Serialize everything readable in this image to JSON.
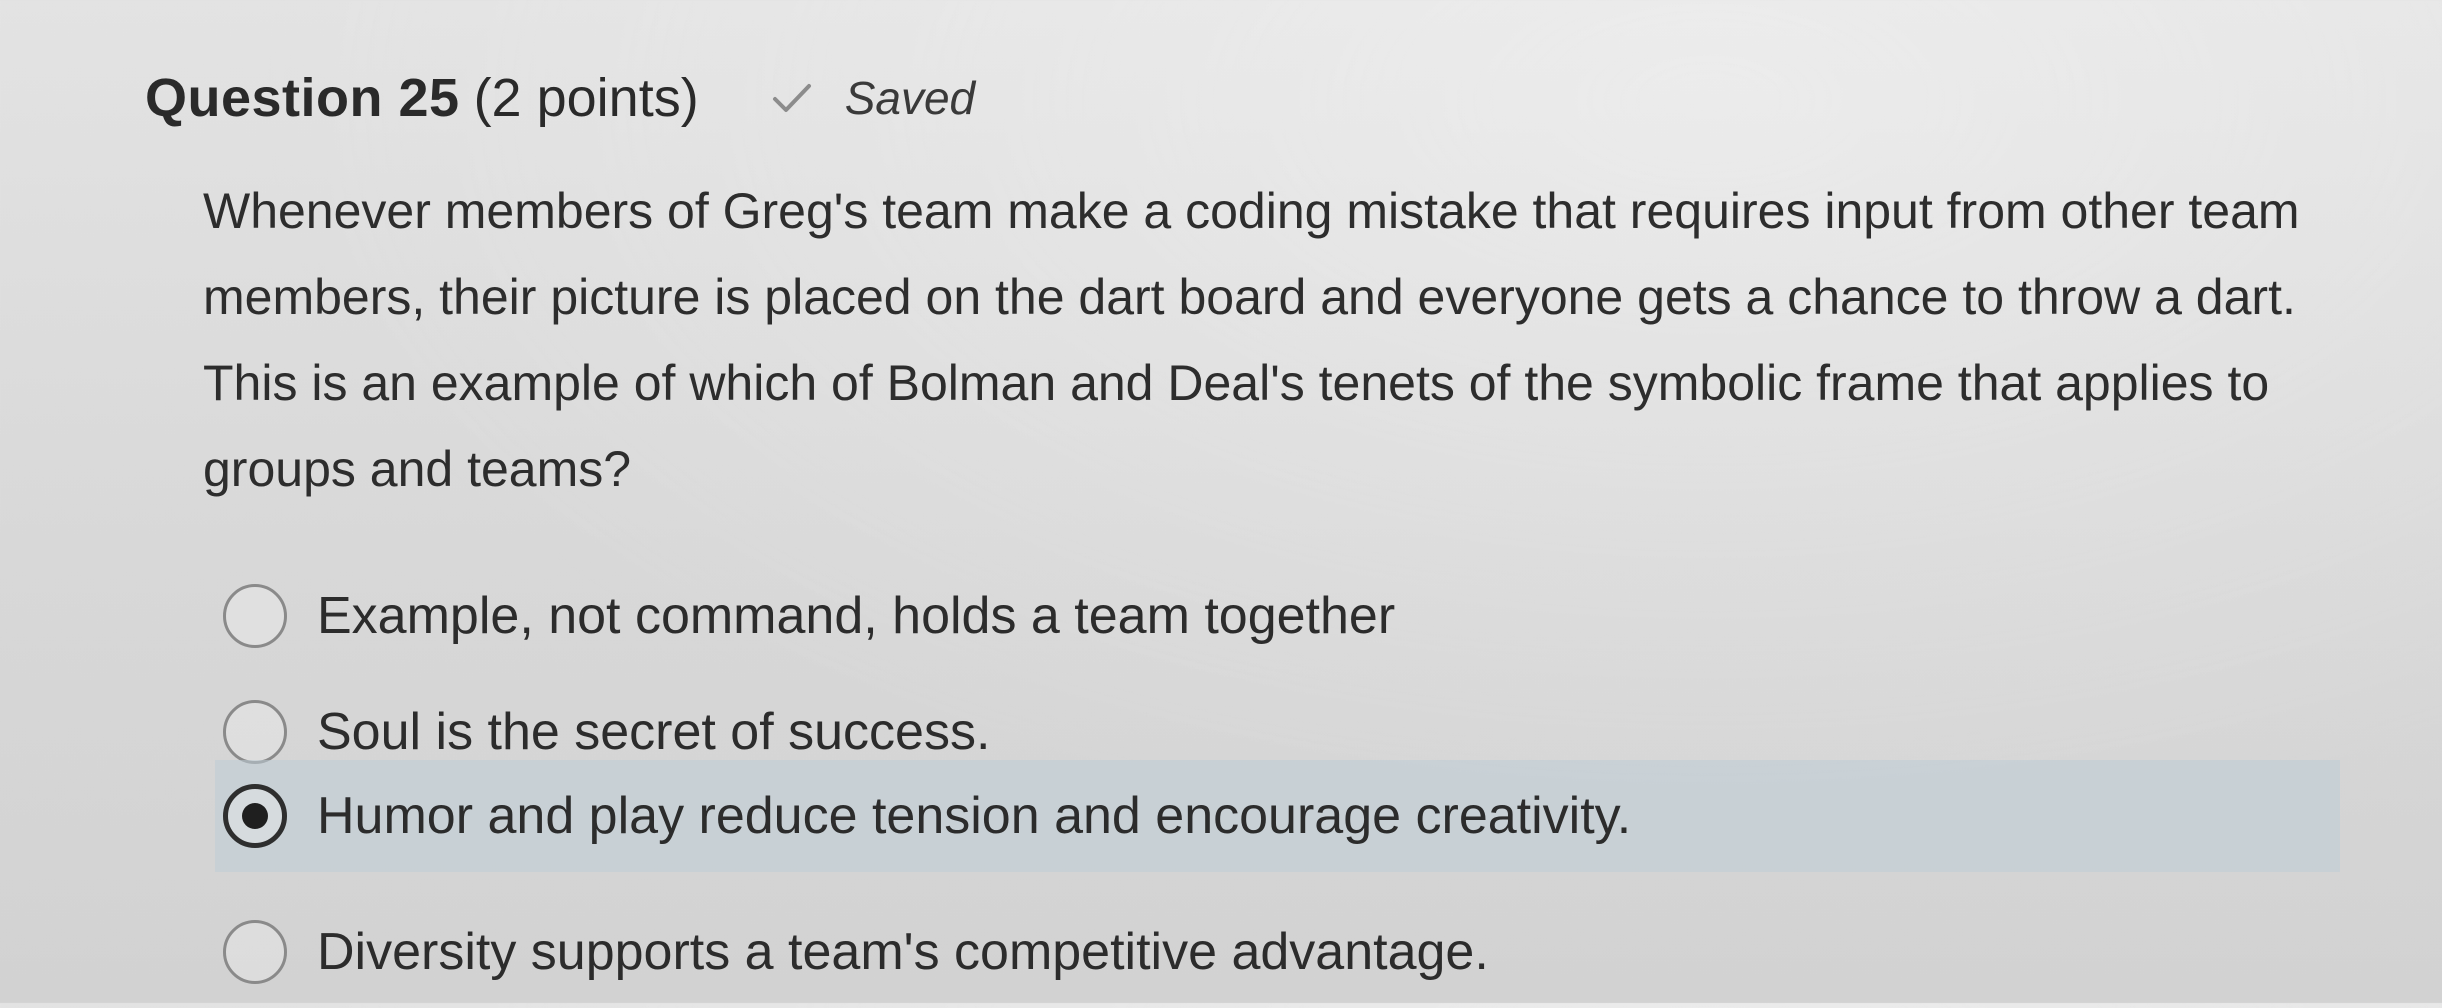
{
  "question": {
    "title": "Question 25",
    "points": "(2 points)",
    "status": "Saved",
    "status_icon": "check-icon",
    "text": "Whenever members of Greg's team make a coding mistake that requires input from other team members, their picture is placed on the dart board and everyone gets a chance to throw a dart. This is an example of which of Bolman and Deal's tenets of the symbolic frame that applies to groups and teams?"
  },
  "options": [
    {
      "label": "Example, not command, holds a team together",
      "selected": false
    },
    {
      "label": "Soul is the secret of success.",
      "selected": false
    },
    {
      "label": "Humor and play reduce tension and encourage creativity.",
      "selected": true
    },
    {
      "label": "Diversity supports a team's competitive advantage.",
      "selected": false
    }
  ],
  "colors": {
    "selected_highlight": "#bccbd6",
    "text": "#2b2b2b"
  }
}
